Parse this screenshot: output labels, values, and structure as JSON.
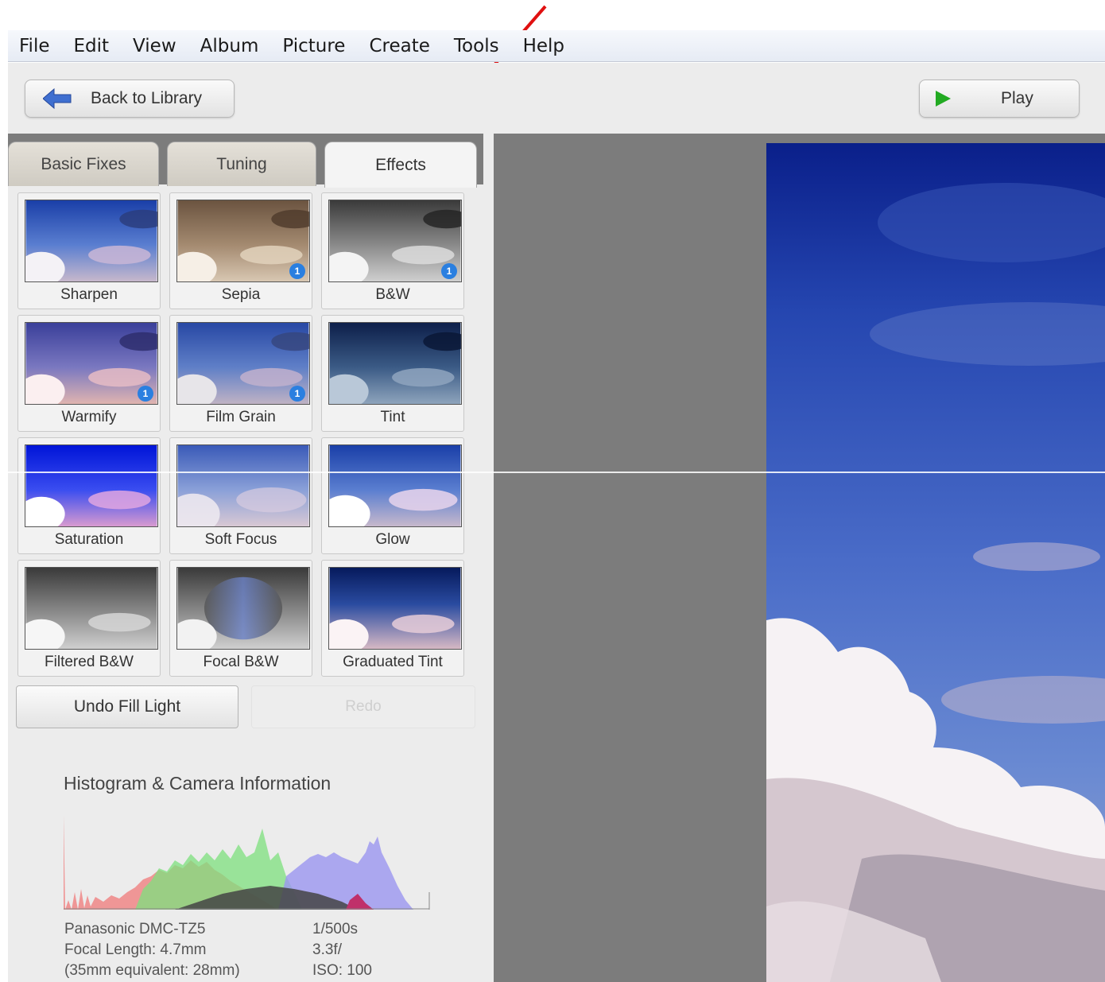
{
  "menu": [
    "File",
    "Edit",
    "View",
    "Album",
    "Picture",
    "Create",
    "Tools",
    "Help"
  ],
  "toolbar": {
    "back_label": "Back to Library",
    "play_label": "Play"
  },
  "tabs": [
    {
      "label": "Basic Fixes",
      "active": false
    },
    {
      "label": "Tuning",
      "active": false
    },
    {
      "label": "Effects",
      "active": true
    }
  ],
  "effects": [
    {
      "label": "Sharpen",
      "badge": ""
    },
    {
      "label": "Sepia",
      "badge": "1"
    },
    {
      "label": "B&W",
      "badge": "1"
    },
    {
      "label": "Warmify",
      "badge": "1"
    },
    {
      "label": "Film Grain",
      "badge": "1"
    },
    {
      "label": "Tint",
      "badge": ""
    },
    {
      "label": "Saturation",
      "badge": ""
    },
    {
      "label": "Soft Focus",
      "badge": ""
    },
    {
      "label": "Glow",
      "badge": ""
    },
    {
      "label": "Filtered B&W",
      "badge": ""
    },
    {
      "label": "Focal B&W",
      "badge": ""
    },
    {
      "label": "Graduated Tint",
      "badge": ""
    }
  ],
  "actions": {
    "undo_label": "Undo Fill Light",
    "redo_label": "Redo"
  },
  "histogram": {
    "title": "Histogram & Camera Information"
  },
  "camera": {
    "model": "Panasonic DMC-TZ5",
    "focal_length": "Focal Length: 4.7mm",
    "equivalent": "(35mm equivalent:  28mm)",
    "shutter": "1/500s",
    "aperture": "3.3f/",
    "iso": "ISO: 100"
  },
  "colors": {
    "accent_blue": "#2a7fe0",
    "play_green": "#22aa22",
    "annotation_arrow": "#e01010",
    "canvas_gray": "#7c7c7c"
  }
}
